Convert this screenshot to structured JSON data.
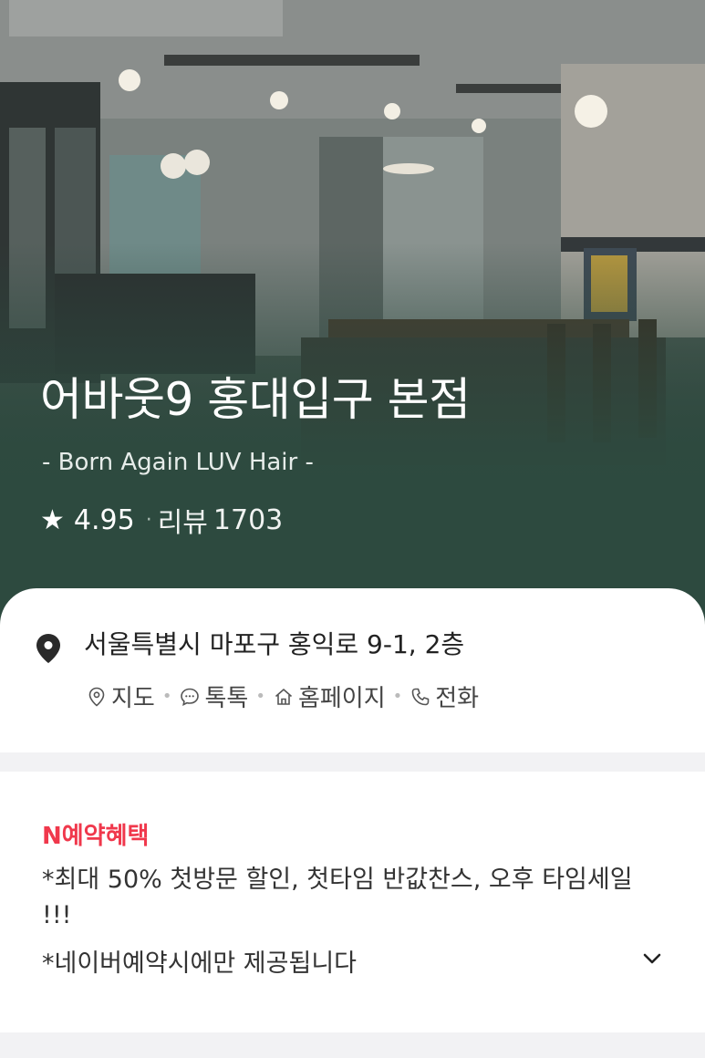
{
  "hero": {
    "name": "어바웃9 홍대입구 본점",
    "subtitle": "- Born Again LUV Hair -",
    "star_icon": "star-icon",
    "rating": "4.95",
    "review_label": "리뷰",
    "review_count": "1703"
  },
  "info": {
    "address": "서울특별시 마포구 홍익로 9-1, 2층",
    "actions": [
      {
        "icon": "map-pin-outline-icon",
        "label": "지도"
      },
      {
        "icon": "chat-bubble-icon",
        "label": "톡톡"
      },
      {
        "icon": "home-icon",
        "label": "홈페이지"
      },
      {
        "icon": "phone-icon",
        "label": "전화"
      }
    ]
  },
  "benefit": {
    "title": "N예약혜택",
    "lines": [
      "*최대 50% 첫방문 할인, 첫타임 반값찬스, 오후 타임세일",
      "!!!",
      "*네이버예약시에만 제공됩니다"
    ],
    "expand_icon": "chevron-down-icon"
  },
  "colors": {
    "hero_green": "#2d4a3f",
    "benefit_accent": "#f0384c"
  }
}
